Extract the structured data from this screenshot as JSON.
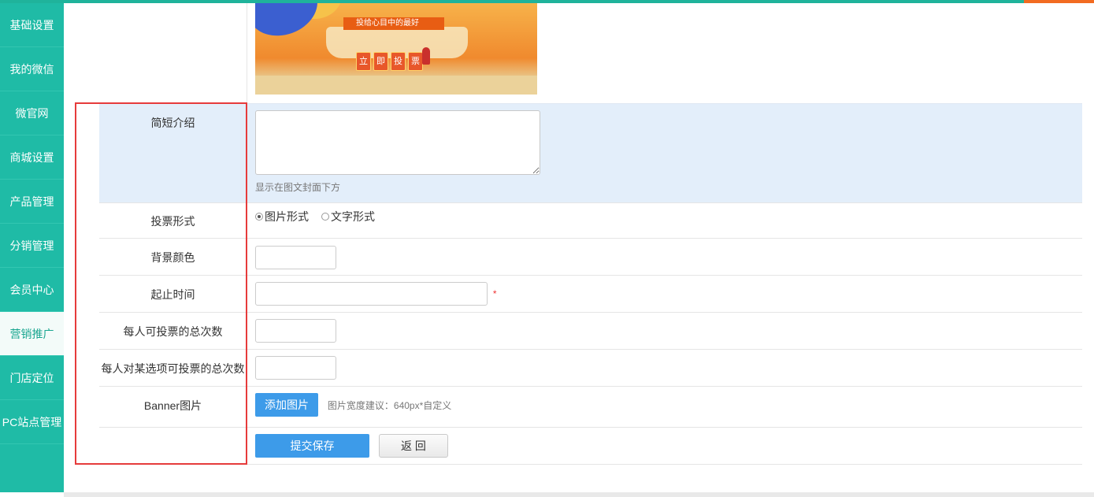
{
  "sidebar": {
    "items": [
      {
        "label": "基础设置"
      },
      {
        "label": "我的微信"
      },
      {
        "label": "微官网"
      },
      {
        "label": "商城设置"
      },
      {
        "label": "产品管理"
      },
      {
        "label": "分销管理"
      },
      {
        "label": "会员中心"
      },
      {
        "label": "营销推广",
        "active": true
      },
      {
        "label": "门店定位"
      },
      {
        "label": "PC站点管理"
      }
    ]
  },
  "banner_preview": {
    "tag_text": "投给心目中的最好",
    "vote_chars": [
      "立",
      "即",
      "投",
      "票"
    ]
  },
  "form": {
    "intro": {
      "label": "简短介绍",
      "value": "",
      "hint": "显示在图文封面下方"
    },
    "vote_type": {
      "label": "投票形式",
      "options": [
        "图片形式",
        "文字形式"
      ],
      "selected": "图片形式"
    },
    "bg_color": {
      "label": "背景颜色",
      "value": ""
    },
    "time_range": {
      "label": "起止时间",
      "value": "",
      "required_mark": "*"
    },
    "total_votes": {
      "label": "每人可投票的总次数",
      "value": ""
    },
    "option_votes": {
      "label": "每人对某选项可投票的总次数",
      "value": ""
    },
    "banner": {
      "label": "Banner图片",
      "button": "添加图片",
      "hint": "图片宽度建议：640px*自定义"
    },
    "actions": {
      "submit": "提交保存",
      "back": "返 回"
    }
  },
  "colors": {
    "sidebar_bg": "#1fbba6",
    "accent_orange": "#f26b21",
    "primary_button": "#3d9be9",
    "highlight_row": "#e3eefa",
    "annotation_box": "#e63b3b"
  }
}
